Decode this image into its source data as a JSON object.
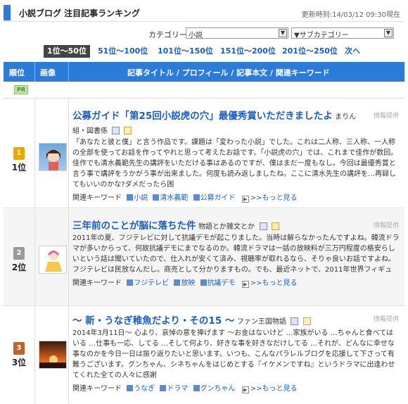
{
  "header": {
    "title": "小説ブログ 注目記事ランキング",
    "updated": "更新時刻:14/03/12 09:30現在"
  },
  "filters": {
    "category_label": "カテゴリー",
    "category_value": "小説",
    "subcategory_value": "▼サブカテゴリー"
  },
  "pager": [
    "1位〜50位",
    "51位〜100位",
    "101位〜150位",
    "151位〜200位",
    "201位〜250位",
    "次へ"
  ],
  "table_header": {
    "rank": "順位",
    "image": "画像",
    "main": "記事タイトル / プロフィール / 記事本文 / 関連キーワード"
  },
  "pr_label": "PR",
  "colors": {
    "accent": "#2b7bd9",
    "link": "#1a5fbf",
    "rank1": "#e8a800",
    "rank2": "#9a9a9a",
    "rank3": "#c0622a"
  },
  "entries": [
    {
      "rank": "1位",
      "rank_icon": "1",
      "title": "公募ガイド「第25回小説虎の穴」最優秀賞いただきましたよ",
      "author": "まりん",
      "jh": "情報提供",
      "meta": "組・図書係",
      "excerpt": "「あなたと彼と僕」と言う作品です。課題は「変わった小説」でした。これは二人称、三人称、一人称の全部を使ってお話を作ってやれと思って考えたお話です。「小説虎の穴」では、これまで佳作が数回。佳作でも清水義範先生の講評をいただける事はあるのですが、僕はまだ一度もなし。今回は最優秀賞と言う事で講評をうかがう事が出来ました。何度も読み返しましたね。ここに清水先生の講評を…再録してもいいのかな?ダメだったら困",
      "keywords_label": "関連キーワード",
      "keywords": [
        "小説",
        "清水義範",
        "公募ガイド"
      ],
      "more": ">>もっと見る"
    },
    {
      "rank": "2位",
      "rank_icon": "2",
      "title": "三年前のことが脳に落ちた件",
      "author": "物語とか雑文とか",
      "jh": "情報提供",
      "meta": "",
      "excerpt": "2011年の夏、フジテレビに対して抗議デモが起こりました。当時は解らなかったんですよね。韓流ドラマが多いからって、何故抗議デモにまでなるのか。韓流ドラマは一話の放映料が三万円程度の格安らしいという話は聞いていたので、仕入れが安くて済み、視聴率が取れるなら、そりゃ良いお話ですよね。フジテレビは民放なんだし。商売として分かりますもの。でも、最近ネットで、2011年世界フィギュ",
      "keywords_label": "関連キーワード",
      "keywords": [
        "フジテレビ",
        "放映",
        "抗議デモ"
      ],
      "more": ">>もっと見る"
    },
    {
      "rank": "3位",
      "rank_icon": "3",
      "title": "〜 新・うなぎ稚魚だより・その15 〜",
      "author": "ファン王国物語",
      "jh": "情報提供",
      "meta": "",
      "excerpt": "2014年3月11日〜 心より、哀悼の意を捧げます 〜お金はないけど …家族がいる …ちゃんと食べてはいる …仕事も一応、してる …そして何より、好きな事を好きなだけしてる …それが、どんなに幸せな事なのかを今日一日は振り返りたいと思います。いつも、こんなパラレルブログを応援して下さって有難うございます。グンちゃん、シネちゃんをはじめとする『イケメンですね』というドラマに出逢わせてくれた全ての人々に感謝",
      "keywords_label": "関連キーワード",
      "keywords": [
        "うなぎ",
        "ドラマ",
        "グンちゃん"
      ],
      "more": ">>もっと見る"
    }
  ]
}
